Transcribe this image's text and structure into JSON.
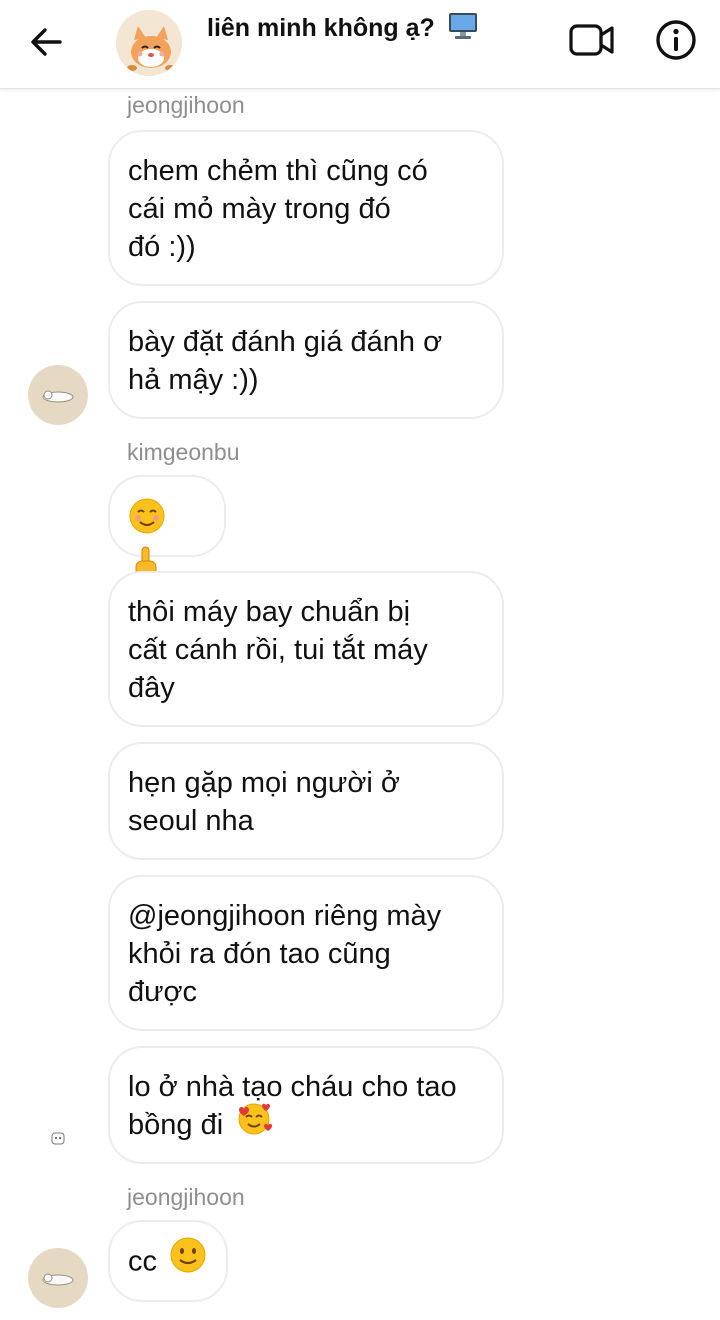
{
  "header": {
    "title": "liên minh không ạ?",
    "title_emoji_icon": "desktop-computer-icon",
    "back_icon": "arrow-left-icon",
    "video_icon": "video-camera-icon",
    "info_icon": "info-circle-icon"
  },
  "messages": [
    {
      "sender": "jeongjihoon"
    },
    {
      "lines": [
        "chem chẻm thì cũng có",
        "cái mỏ mày trong đó",
        "đó :))"
      ]
    },
    {
      "lines": [
        "bày đặt đánh giá đánh ơ",
        "hả mậy :))"
      ]
    },
    {
      "sender": "kimgeonbu"
    },
    {
      "emoji": [
        "smiling-face-icon",
        "pointing-up-hand-icon"
      ]
    },
    {
      "lines": [
        "thôi máy bay chuẩn bị",
        "cất cánh rồi, tui tắt máy",
        "đây"
      ]
    },
    {
      "lines": [
        "hẹn gặp mọi người ở",
        "seoul nha"
      ]
    },
    {
      "lines": [
        "@jeongjihoon riêng mày",
        "khỏi ra đón tao cũng",
        "được"
      ]
    },
    {
      "lines": [
        "lo ở nhà tạo cháu cho tao",
        "bồng đi"
      ],
      "trailing_emoji": "smiling-face-with-hearts-icon"
    },
    {
      "sender": "jeongjihoon"
    },
    {
      "text": "cc",
      "trailing_emoji": "slightly-smiling-face-icon"
    }
  ],
  "colors": {
    "bubble_border": "#ececec",
    "sender_name": "#8e8e8e",
    "avatar_bg": "#e6d9c3"
  }
}
